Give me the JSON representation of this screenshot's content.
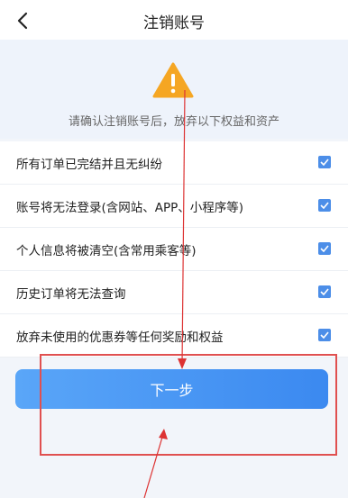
{
  "header": {
    "title": "注销账号",
    "back_icon": "chevron-left-icon"
  },
  "warning": {
    "icon": "warning-triangle-icon",
    "text": "请确认注销账号后，放弃以下权益和资产"
  },
  "items": [
    {
      "label": "所有订单已完结并且无纠纷",
      "checked": true
    },
    {
      "label": "账号将无法登录(含网站、APP、小程序等)",
      "checked": true
    },
    {
      "label": "个人信息将被清空(含常用乘客等)",
      "checked": true
    },
    {
      "label": "历史订单将无法查询",
      "checked": true
    },
    {
      "label": "放弃未使用的优惠券等任何奖励和权益",
      "checked": true
    }
  ],
  "next_button": {
    "label": "下一步"
  },
  "colors": {
    "accent": "#4c8ee8",
    "warning": "#f5a623",
    "annotation": "#e05050"
  }
}
